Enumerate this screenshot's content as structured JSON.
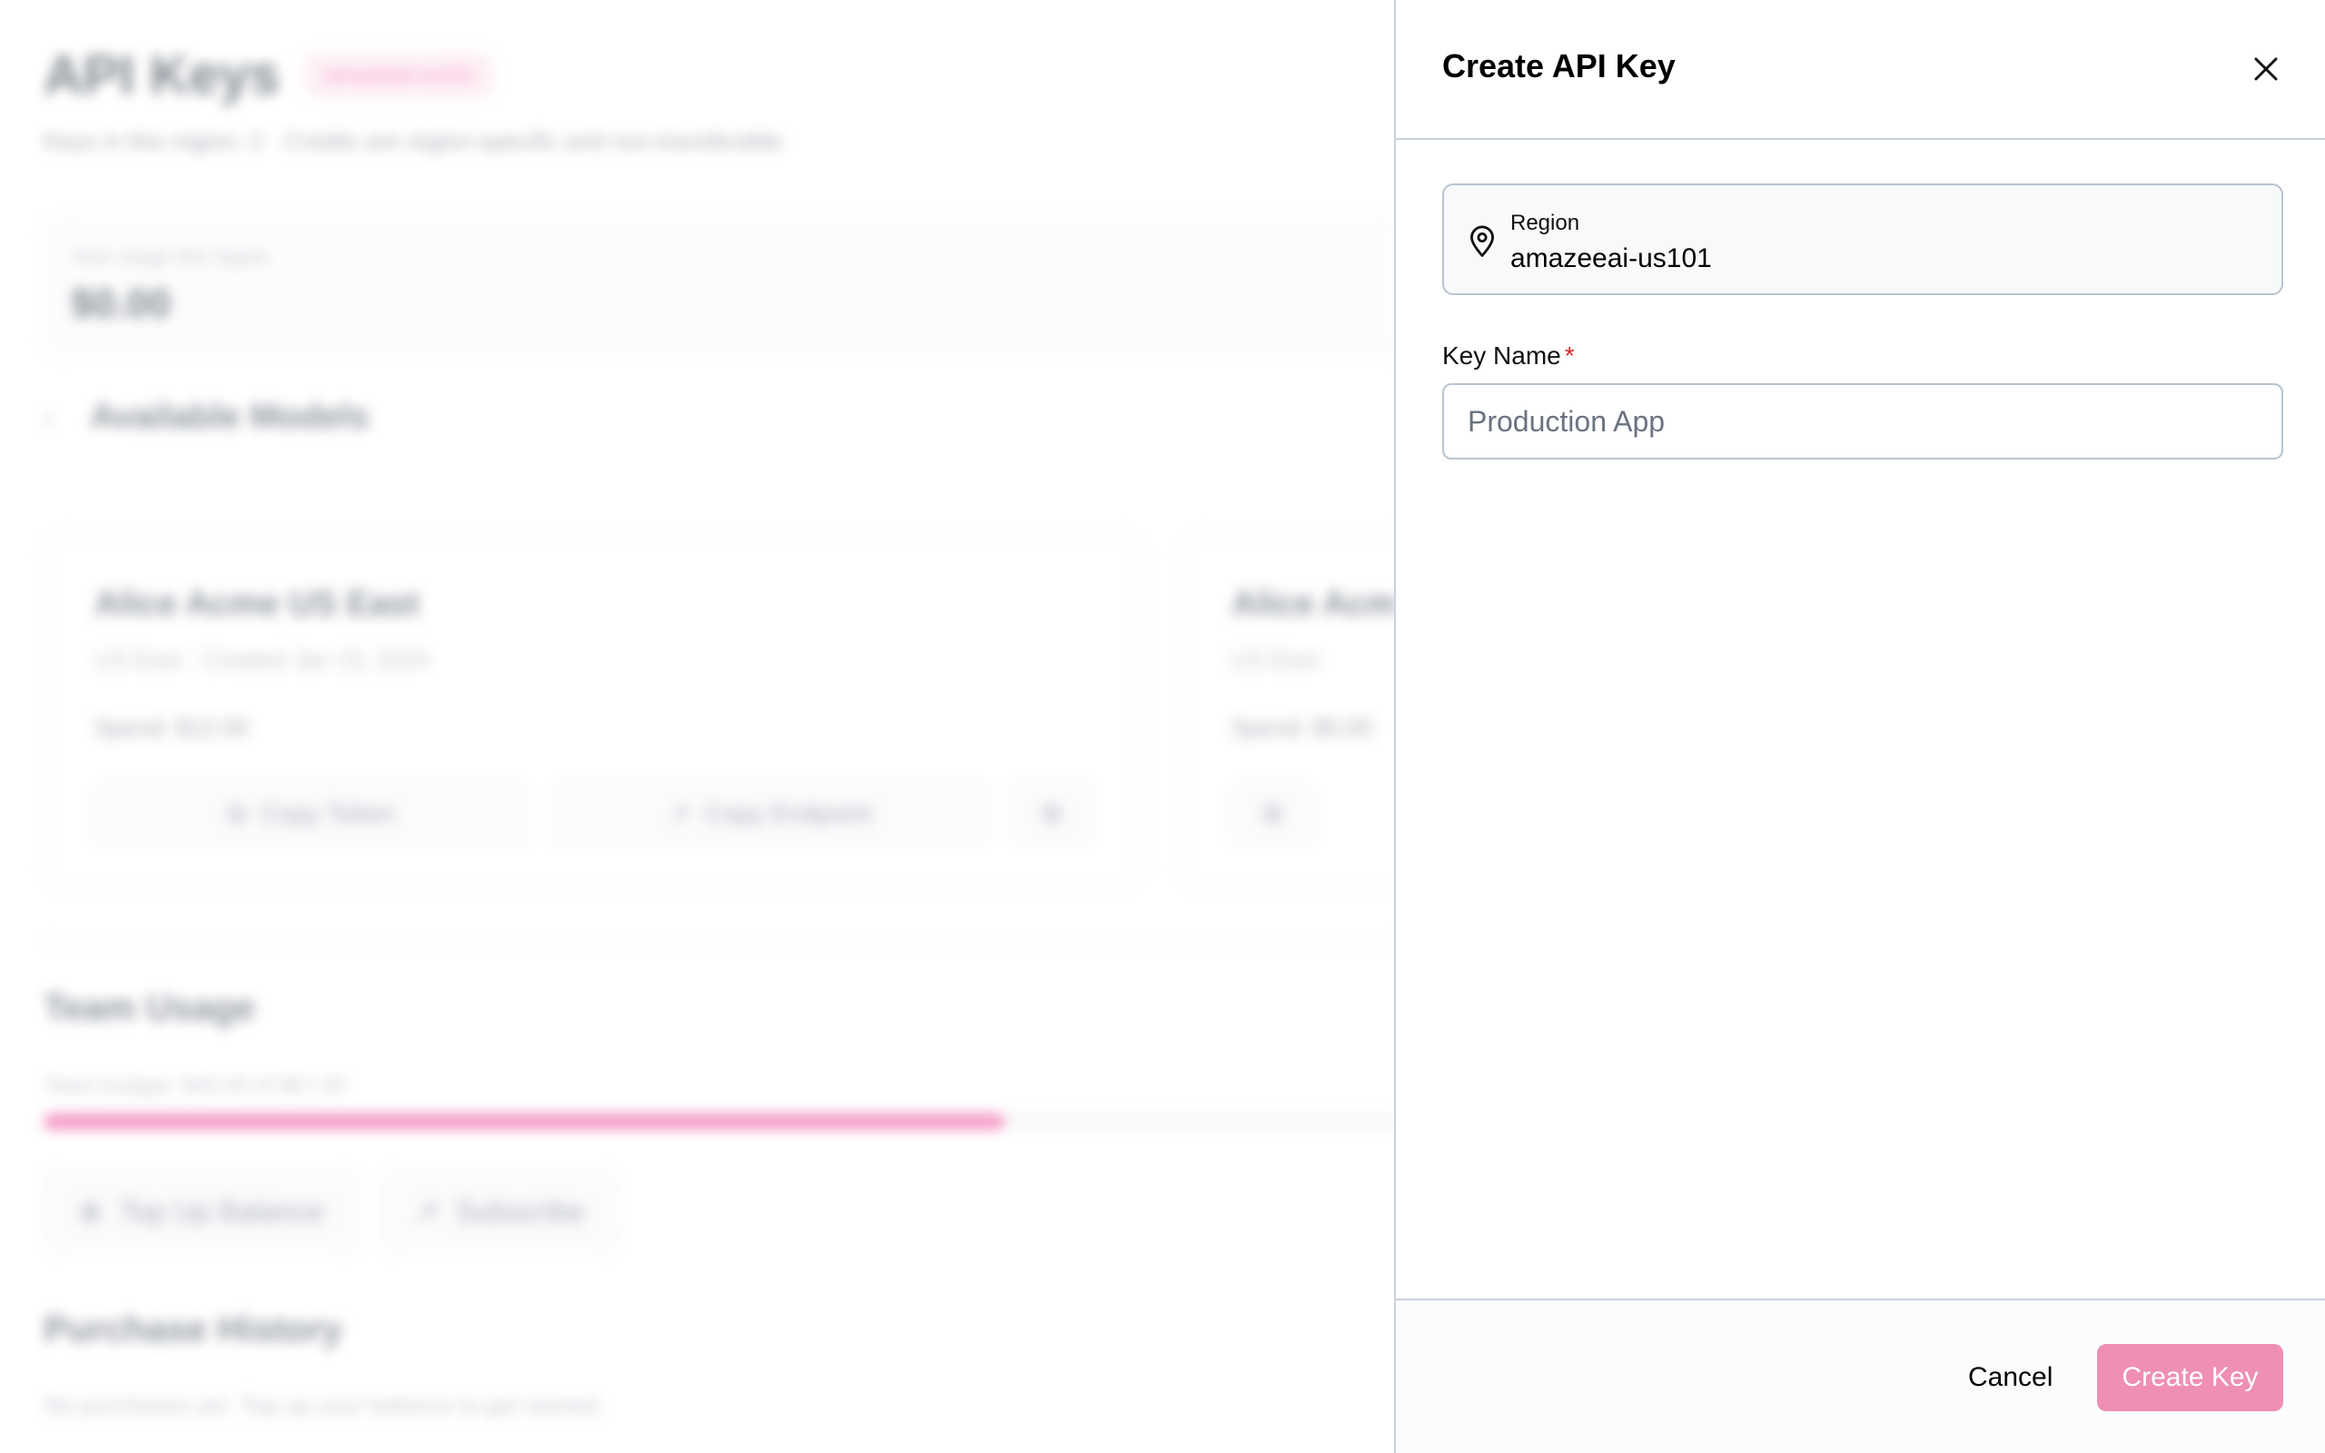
{
  "background": {
    "title": "API Keys",
    "badge": "amazeeai-us101",
    "subtitle": "Keys in this region: 2 · Credits are region-specific and non-transferable",
    "usage": {
      "label": "Your usage this region",
      "value": "$0.00"
    },
    "available_models": "Available Models",
    "keys": [
      {
        "name": "Alice Acme US East",
        "region": "US East",
        "created": "Created Jan 15, 2024",
        "spend": "Spend: $12.00",
        "copy_token": "Copy Token",
        "copy_endpoint": "Copy Endpoint"
      },
      {
        "name": "Alice Acme",
        "region": "US East",
        "spend": "Spend: $0.00"
      }
    ],
    "team_usage": {
      "title": "Team Usage",
      "budget": "Team budget: $45.00 of $67.00",
      "progress": 0.705
    },
    "top_up_label": "Top Up Balance",
    "subscribe_label": "Subscribe",
    "purchase_history": {
      "title": "Purchase History",
      "empty": "No purchases yet. Top up your balance to get started."
    }
  },
  "drawer": {
    "title": "Create API Key",
    "region": {
      "label": "Region",
      "value": "amazeeai-us101"
    },
    "key_name": {
      "label": "Key Name",
      "required_mark": "*",
      "placeholder": "Production App",
      "value": ""
    },
    "cancel_label": "Cancel",
    "create_label": "Create Key"
  },
  "colors": {
    "accent": "#ee8fb3",
    "brand_pink": "#ec4899",
    "required": "#dc2626",
    "border": "#c9d2dd"
  },
  "icons": {
    "close": "close-icon",
    "region": "map-pin-icon",
    "chevron": "chevron-right-icon",
    "copy": "copy-icon",
    "external": "external-link-icon",
    "gear": "gear-icon",
    "plus": "plus-icon"
  }
}
